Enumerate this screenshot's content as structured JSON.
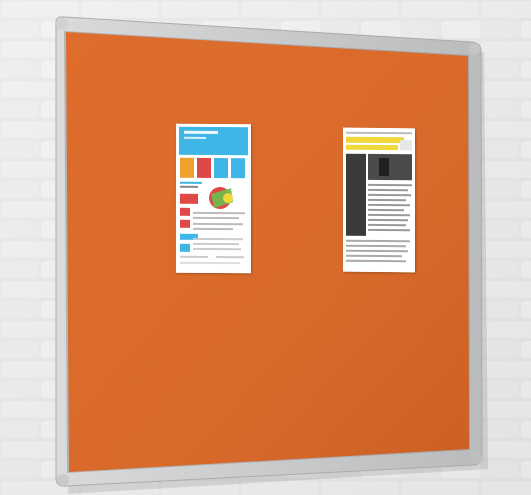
{
  "scene": {
    "description_type": "photo",
    "subject": "notice-board",
    "colors": {
      "wall": "#e6e6e4",
      "mortar": "#f3f3f1",
      "felt": "#d9692a",
      "felt_dark": "#c95e23",
      "frame": "#c9cbcd",
      "frame_shadow": "#9ea0a2",
      "poster_paper": "#ffffff",
      "poster_cyan": "#3fb6e6",
      "poster_red": "#e04848",
      "poster_yellow": "#f0d83a",
      "poster_dark": "#3b3b3b"
    }
  }
}
